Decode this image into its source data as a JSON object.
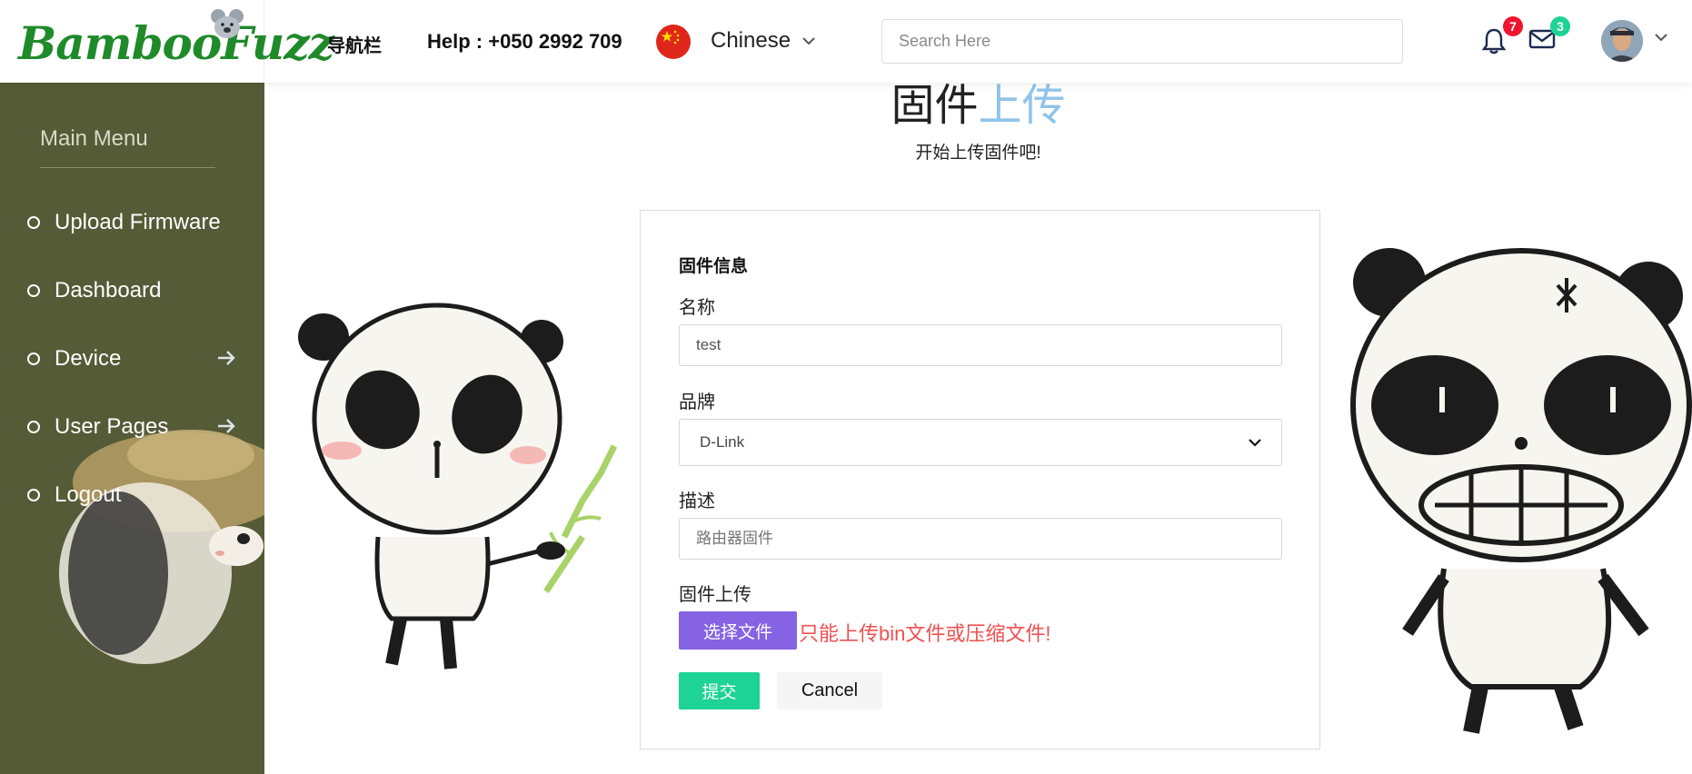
{
  "header": {
    "logo_text": "BambooFuzz",
    "nav_label": "导航栏",
    "help_text": "Help : +050 2992 709",
    "language": "Chinese",
    "search_placeholder": "Search Here",
    "notifications_count": "7",
    "messages_count": "3",
    "badge_colors": {
      "notifications": "#f0142f",
      "messages": "#1dd395"
    }
  },
  "sidebar": {
    "title": "Main Menu",
    "items": [
      {
        "label": "Upload Firmware",
        "has_arrow": false
      },
      {
        "label": "Dashboard",
        "has_arrow": false
      },
      {
        "label": "Device",
        "has_arrow": true
      },
      {
        "label": "User Pages",
        "has_arrow": true
      },
      {
        "label": "Logout",
        "has_arrow": false
      }
    ],
    "background": "#555b36"
  },
  "main": {
    "title_part1": "固件",
    "title_part2": "上传",
    "subtitle": "开始上传固件吧!",
    "form": {
      "heading": "固件信息",
      "name_label": "名称",
      "name_value": "test",
      "brand_label": "品牌",
      "brand_value": "D-Link",
      "desc_label": "描述",
      "desc_placeholder": "路由器固件",
      "upload_label": "固件上传",
      "choose_file_label": "选择文件",
      "upload_note": "只能上传bin文件或压缩文件!",
      "submit_label": "提交",
      "cancel_label": "Cancel"
    },
    "colors": {
      "accent": "#8fc3ea",
      "choose_button": "#8663e2",
      "submit_button": "#1dd395",
      "warning": "#f05050"
    }
  }
}
